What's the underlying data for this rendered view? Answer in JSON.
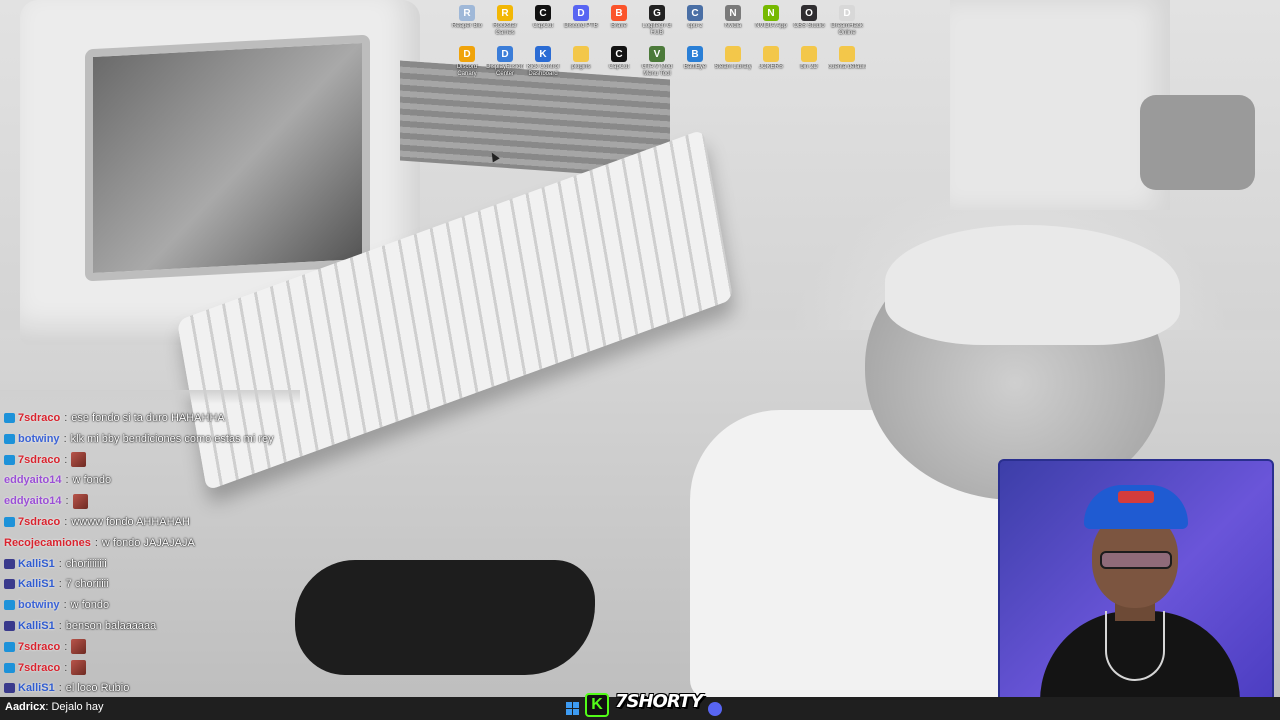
{
  "desktop": {
    "icons": [
      {
        "name": "Reaper Bio",
        "icon": "app-icon",
        "color": "#9fb8d8",
        "glyph": "R"
      },
      {
        "name": "Rockstar Games",
        "icon": "rockstar-icon",
        "color": "#f2b705",
        "glyph": "R"
      },
      {
        "name": "CapCut",
        "icon": "capcut-icon",
        "color": "#111111",
        "glyph": "C"
      },
      {
        "name": "Discord PTB",
        "icon": "discord-icon",
        "color": "#5865f2",
        "glyph": "D"
      },
      {
        "name": "Brave",
        "icon": "brave-icon",
        "color": "#fb542b",
        "glyph": "B"
      },
      {
        "name": "Logitech G HUB",
        "icon": "logitech-icon",
        "color": "#222222",
        "glyph": "G"
      },
      {
        "name": "cpu-z",
        "icon": "cpuz-icon",
        "color": "#4a6fa5",
        "glyph": "C"
      },
      {
        "name": "Nvidia",
        "icon": "monitor-icon",
        "color": "#7a7a7a",
        "glyph": "N"
      },
      {
        "name": "NVIDIA App",
        "icon": "nvidia-icon",
        "color": "#76b900",
        "glyph": "N"
      },
      {
        "name": "OBS Studio",
        "icon": "obs-icon",
        "color": "#302e31",
        "glyph": "O"
      },
      {
        "name": "DreamHack Online",
        "icon": "app-icon",
        "color": "#d8d8d8",
        "glyph": "D"
      },
      {
        "name": "Discord Canary",
        "icon": "canary-icon",
        "color": "#f0a30a",
        "glyph": "D"
      },
      {
        "name": "DisplayFusion Center",
        "icon": "display-icon",
        "color": "#3b7dd8",
        "glyph": "D"
      },
      {
        "name": "Kick Control Dashboard",
        "icon": "kick-icon",
        "color": "#2b6cd4",
        "glyph": "K"
      },
      {
        "name": "plugins",
        "icon": "folder-icon",
        "color": "#f3c74a",
        "glyph": ""
      },
      {
        "name": "CapCut",
        "icon": "capcut-icon",
        "color": "#111111",
        "glyph": "C"
      },
      {
        "name": "GTA V Mod Menu Tool",
        "icon": "gta-icon",
        "color": "#4c7a3a",
        "glyph": "V"
      },
      {
        "name": "BattlEye",
        "icon": "battleye-icon",
        "color": "#2a7fd6",
        "glyph": "B"
      },
      {
        "name": "Steam Library",
        "icon": "folder-icon",
        "color": "#f3c74a",
        "glyph": ""
      },
      {
        "name": "JOKERS",
        "icon": "folder-icon",
        "color": "#f3c74a",
        "glyph": ""
      },
      {
        "name": "bin 2D",
        "icon": "folder-icon",
        "color": "#f3c74a",
        "glyph": ""
      },
      {
        "name": "cuenta default",
        "icon": "folder-icon",
        "color": "#f3c74a",
        "glyph": ""
      }
    ]
  },
  "chat": {
    "messages": [
      {
        "badge": "twitch",
        "user": "7sdraco",
        "color": "#d9232e",
        "text": "ese fondo si ta duro HAHAHHA",
        "emote": false
      },
      {
        "badge": "twitch",
        "user": "botwiny",
        "color": "#3b63d6",
        "text": "klk mi bby bendiciones como estas mi rey",
        "emote": false
      },
      {
        "badge": "twitch",
        "user": "7sdraco",
        "color": "#d9232e",
        "text": "",
        "emote": true
      },
      {
        "badge": "none",
        "user": "eddyaito14",
        "color": "#9b4fd6",
        "text": "w fondo",
        "emote": false
      },
      {
        "badge": "none",
        "user": "eddyaito14",
        "color": "#9b4fd6",
        "text": "",
        "emote": true
      },
      {
        "badge": "twitch",
        "user": "7sdraco",
        "color": "#d9232e",
        "text": "wwww fondo AHHAHAH",
        "emote": false
      },
      {
        "badge": "none",
        "user": "Recojecamiones",
        "color": "#d9232e",
        "text": "w fondo JAJAJAJA",
        "emote": false
      },
      {
        "badge": "kick",
        "user": "KalliS1",
        "color": "#2f5bd0",
        "text": "choriiiiiiii",
        "emote": false
      },
      {
        "badge": "kick",
        "user": "KalliS1",
        "color": "#2f5bd0",
        "text": "7 choriiiii",
        "emote": false
      },
      {
        "badge": "twitch",
        "user": "botwiny",
        "color": "#3b63d6",
        "text": "w fondo",
        "emote": false
      },
      {
        "badge": "kick",
        "user": "KalliS1",
        "color": "#2f5bd0",
        "text": "benson balaaaaaa",
        "emote": false
      },
      {
        "badge": "twitch",
        "user": "7sdraco",
        "color": "#d9232e",
        "text": "",
        "emote": true
      },
      {
        "badge": "twitch",
        "user": "7sdraco",
        "color": "#d9232e",
        "text": "",
        "emote": true
      },
      {
        "badge": "kick",
        "user": "KalliS1",
        "color": "#2f5bd0",
        "text": "el loco Rubio",
        "emote": false
      }
    ]
  },
  "ticker": {
    "user": "Aadricx",
    "text": "Dejalo hay"
  },
  "taskbar": {
    "kick_glyph": "K",
    "brand_text": "7SHORTY"
  }
}
